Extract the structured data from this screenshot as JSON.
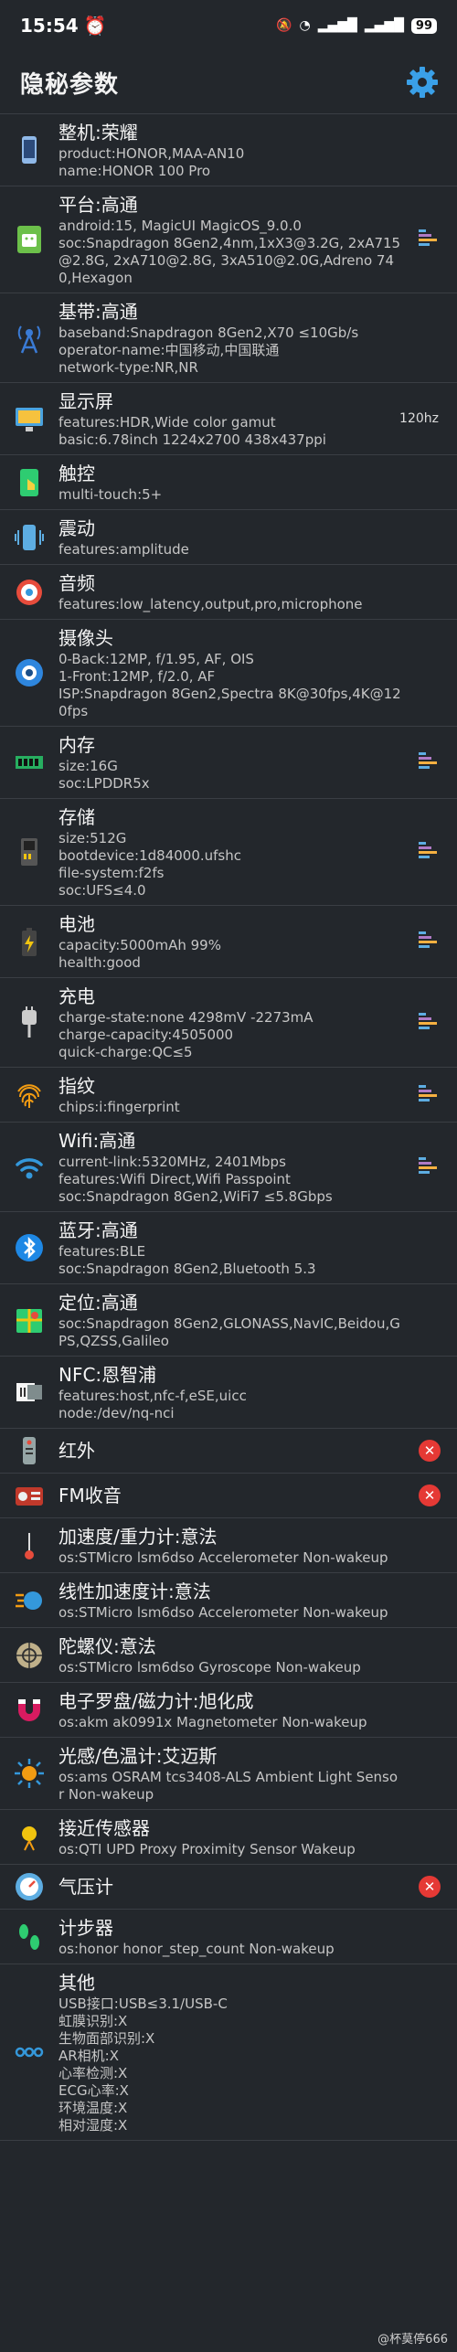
{
  "status_bar": {
    "time": "15:54",
    "battery": "99"
  },
  "header": {
    "title": "隐秘参数"
  },
  "rows": [
    {
      "title": "整机:荣耀",
      "lines": [
        "product:HONOR,MAA-AN10",
        "name:HONOR 100 Pro"
      ],
      "icon": "phone-icon",
      "side": ""
    },
    {
      "title": "平台:高通",
      "lines": [
        "android:15, MagicUI MagicOS_9.0.0",
        "soc:Snapdragon 8Gen2,4nm,1xX3@3.2G, 2xA715@2.8G, 2xA710@2.8G, 3xA510@2.0G,Adreno 740,Hexagon"
      ],
      "icon": "android-icon",
      "side": "bars"
    },
    {
      "title": "基带:高通",
      "lines": [
        "baseband:Snapdragon 8Gen2,X70 ≤10Gb/s",
        "operator-name:中国移动,中国联通",
        "network-type:NR,NR"
      ],
      "icon": "antenna-icon",
      "side": ""
    },
    {
      "title": "显示屏",
      "lines": [
        "features:HDR,Wide color gamut",
        "basic:6.78inch 1224x2700 438x437ppi"
      ],
      "icon": "display-icon",
      "side": "text",
      "side_text": "120hz"
    },
    {
      "title": "触控",
      "lines": [
        "multi-touch:5+"
      ],
      "icon": "touch-icon",
      "side": ""
    },
    {
      "title": "震动",
      "lines": [
        "features:amplitude"
      ],
      "icon": "vibration-icon",
      "side": ""
    },
    {
      "title": "音频",
      "lines": [
        "features:low_latency,output,pro,microphone"
      ],
      "icon": "audio-icon",
      "side": ""
    },
    {
      "title": "摄像头",
      "lines": [
        "0-Back:12MP, f/1.95, AF, OIS",
        "1-Front:12MP, f/2.0, AF",
        "ISP:Snapdragon 8Gen2,Spectra 8K@30fps,4K@120fps"
      ],
      "icon": "camera-icon",
      "side": ""
    },
    {
      "title": "内存",
      "lines": [
        "size:16G",
        "soc:LPDDR5x"
      ],
      "icon": "memory-icon",
      "side": "bars"
    },
    {
      "title": "存储",
      "lines": [
        "size:512G",
        "bootdevice:1d84000.ufshc",
        "file-system:f2fs",
        "soc:UFS≤4.0"
      ],
      "icon": "storage-icon",
      "side": "bars"
    },
    {
      "title": "电池",
      "lines": [
        "capacity:5000mAh 99%",
        "health:good"
      ],
      "icon": "battery-icon",
      "side": "bars"
    },
    {
      "title": "充电",
      "lines": [
        "charge-state:none 4298mV -2273mA",
        "charge-capacity:4505000",
        "quick-charge:QC≤5"
      ],
      "icon": "charger-icon",
      "side": "bars"
    },
    {
      "title": "指纹",
      "lines": [
        "chips:i:fingerprint"
      ],
      "icon": "fingerprint-icon",
      "side": "bars"
    },
    {
      "title": "Wifi:高通",
      "lines": [
        "current-link:5320MHz, 2401Mbps",
        "features:Wifi Direct,Wifi Passpoint",
        "soc:Snapdragon 8Gen2,WiFi7 ≤5.8Gbps"
      ],
      "icon": "wifi-icon",
      "side": "bars"
    },
    {
      "title": "蓝牙:高通",
      "lines": [
        "features:BLE",
        "soc:Snapdragon 8Gen2,Bluetooth 5.3"
      ],
      "icon": "bluetooth-icon",
      "side": ""
    },
    {
      "title": "定位:高通",
      "lines": [
        "soc:Snapdragon 8Gen2,GLONASS,NavIC,Beidou,GPS,QZSS,Galileo"
      ],
      "icon": "map-icon",
      "side": ""
    },
    {
      "title": "NFC:恩智浦",
      "lines": [
        "features:host,nfc-f,eSE,uicc",
        "node:/dev/nq-nci"
      ],
      "icon": "nfc-icon",
      "side": ""
    },
    {
      "title": "红外",
      "lines": [],
      "icon": "remote-icon",
      "side": "error"
    },
    {
      "title": "FM收音",
      "lines": [],
      "icon": "radio-icon",
      "side": "error"
    },
    {
      "title": "加速度/重力计:意法",
      "lines": [
        "os:STMicro lsm6dso Accelerometer Non-wakeup"
      ],
      "icon": "accelerometer-icon",
      "side": ""
    },
    {
      "title": "线性加速度计:意法",
      "lines": [
        "os:STMicro lsm6dso Accelerometer Non-wakeup"
      ],
      "icon": "linear-acceleration-icon",
      "side": ""
    },
    {
      "title": "陀螺仪:意法",
      "lines": [
        "os:STMicro lsm6dso Gyroscope Non-wakeup"
      ],
      "icon": "gyroscope-icon",
      "side": ""
    },
    {
      "title": "电子罗盘/磁力计:旭化成",
      "lines": [
        "os:akm ak0991x Magnetometer Non-wakeup"
      ],
      "icon": "magnet-icon",
      "side": ""
    },
    {
      "title": "光感/色温计:艾迈斯",
      "lines": [
        "os:ams OSRAM tcs3408-ALS Ambient Light Sensor Non-wakeup"
      ],
      "icon": "light-sensor-icon",
      "side": ""
    },
    {
      "title": "接近传感器",
      "lines": [
        "os:QTI UPD Proxy Proximity Sensor Wakeup"
      ],
      "icon": "proximity-icon",
      "side": ""
    },
    {
      "title": "气压计",
      "lines": [],
      "icon": "barometer-icon",
      "side": "error"
    },
    {
      "title": "计步器",
      "lines": [
        "os:honor honor_step_count  Non-wakeup"
      ],
      "icon": "footsteps-icon",
      "side": ""
    },
    {
      "title": "其他",
      "lines": [
        "USB接口:USB≤3.1/USB-C",
        "虹膜识别:X",
        "生物面部识别:X",
        "AR相机:X",
        "心率检测:X",
        "ECG心率:X",
        "环境温度:X",
        "相对湿度:X"
      ],
      "icon": "more-icon",
      "side": ""
    }
  ],
  "error_mark": "✕",
  "footer": {
    "watermark": "@杯莫停666"
  }
}
